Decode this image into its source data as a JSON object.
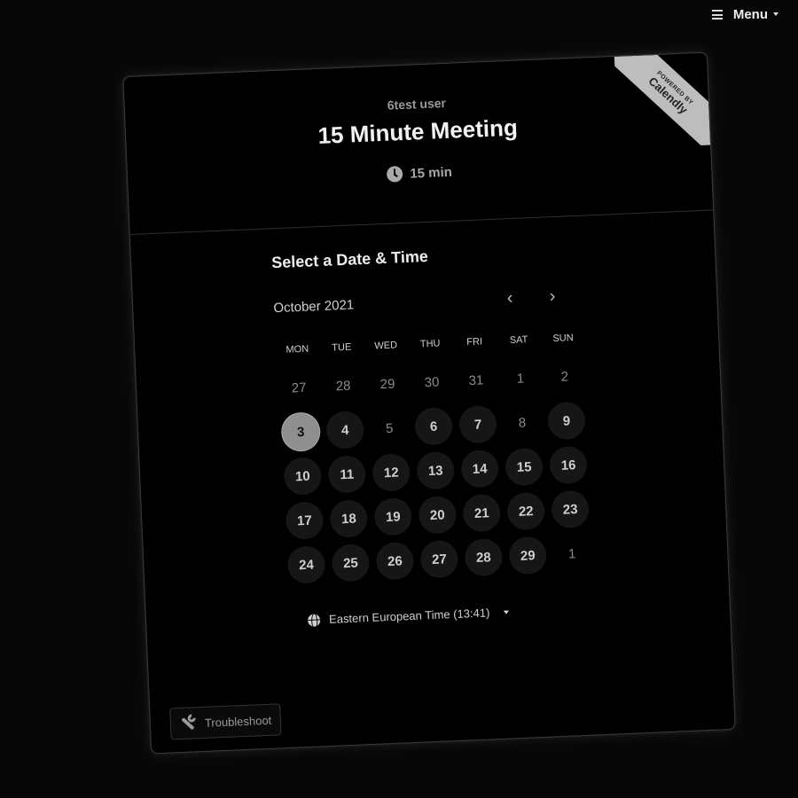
{
  "topbar": {
    "menu_label": "Menu"
  },
  "ribbon": {
    "powered": "POWERED BY",
    "brand": "Calendly"
  },
  "event": {
    "host": "6test user",
    "title": "15 Minute Meeting",
    "duration": "15 min"
  },
  "calendar": {
    "section_title": "Select a Date & Time",
    "month": "October 2021",
    "weekdays": [
      "MON",
      "TUE",
      "WED",
      "THU",
      "FRI",
      "SAT",
      "SUN"
    ],
    "days": [
      {
        "label": "27",
        "state": "other"
      },
      {
        "label": "28",
        "state": "other"
      },
      {
        "label": "29",
        "state": "other"
      },
      {
        "label": "30",
        "state": "other"
      },
      {
        "label": "31",
        "state": "other"
      },
      {
        "label": "1",
        "state": "unavail"
      },
      {
        "label": "2",
        "state": "unavail"
      },
      {
        "label": "3",
        "state": "selected"
      },
      {
        "label": "4",
        "state": "avail"
      },
      {
        "label": "5",
        "state": "unavail"
      },
      {
        "label": "6",
        "state": "avail"
      },
      {
        "label": "7",
        "state": "avail"
      },
      {
        "label": "8",
        "state": "unavail"
      },
      {
        "label": "9",
        "state": "avail"
      },
      {
        "label": "10",
        "state": "avail"
      },
      {
        "label": "11",
        "state": "avail"
      },
      {
        "label": "12",
        "state": "avail"
      },
      {
        "label": "13",
        "state": "avail"
      },
      {
        "label": "14",
        "state": "avail"
      },
      {
        "label": "15",
        "state": "avail"
      },
      {
        "label": "16",
        "state": "avail"
      },
      {
        "label": "17",
        "state": "avail"
      },
      {
        "label": "18",
        "state": "avail"
      },
      {
        "label": "19",
        "state": "avail"
      },
      {
        "label": "20",
        "state": "avail"
      },
      {
        "label": "21",
        "state": "avail"
      },
      {
        "label": "22",
        "state": "avail"
      },
      {
        "label": "23",
        "state": "avail"
      },
      {
        "label": "24",
        "state": "avail"
      },
      {
        "label": "25",
        "state": "avail"
      },
      {
        "label": "26",
        "state": "avail"
      },
      {
        "label": "27",
        "state": "avail"
      },
      {
        "label": "28",
        "state": "avail"
      },
      {
        "label": "29",
        "state": "avail"
      },
      {
        "label": "1",
        "state": "other"
      }
    ],
    "timezone": "Eastern European Time (13:41)"
  },
  "footer": {
    "troubleshoot": "Troubleshoot"
  }
}
